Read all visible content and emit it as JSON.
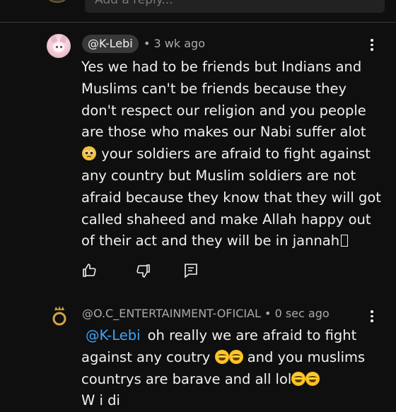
{
  "reply_box": {
    "placeholder": "Add a reply..."
  },
  "comments": [
    {
      "author": "@K-Lebi",
      "meta": "• 3 wk ago",
      "text": "Yes we had to be friends but Indians and Muslims can't be friends because they don't respect our religion and you people are those who makes our Nabi suffer alot",
      "text_after_emoji": "your soldiers are afraid to fight against any country but Muslim soldiers are not afraid because they know that they will got called shaheed and make Allah happy out of their act and they will be in jannah",
      "emoji": "pleading-face-emoji",
      "missing_glyph": "tofu-box"
    },
    {
      "author": "@O.C_ENTERTAINMENT-OFICIAL",
      "meta": "• 0 sec ago",
      "mention": "@K-Lebi",
      "text_part1": "oh really we are afraid to fight against any coutry",
      "text_part2": "and you muslims countrys are barave and all lol",
      "text_cut": "W i di",
      "emoji": "grinning-sweat-emoji"
    }
  ],
  "icons": [
    "like-icon",
    "dislike-icon",
    "reply-icon",
    "more-vert-icon"
  ],
  "colors": {
    "background": "#0f0f0f",
    "text": "#f1f1f1",
    "muted": "#aaaaaa",
    "mention": "#3ea6ff",
    "chip": "#383838"
  }
}
